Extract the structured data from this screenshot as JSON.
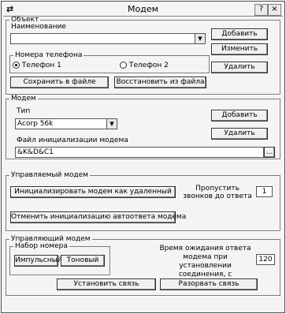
{
  "window": {
    "title": "Модем",
    "controls": {
      "help": "?",
      "close": "×"
    }
  },
  "object_group": {
    "legend": "Объект",
    "name_label": "Наименование",
    "name_value": "",
    "add_button": "Добавить",
    "edit_button": "Изменить",
    "delete_button": "Удалить",
    "phone_group": {
      "legend": "Номера телефона",
      "phone1": "Телефон 1",
      "phone2": "Телефон 2",
      "selected": "phone1"
    },
    "save_button": "Сохранить в файле",
    "restore_button": "Восстановить из файла"
  },
  "modem_group": {
    "legend": "Модем",
    "type_label": "Тип",
    "type_value": "Acorp 56k",
    "add_button": "Добавить",
    "delete_button": "Удалить",
    "init_file_label": "Файл инициализации модема",
    "init_file_value": "&K&D&C1",
    "browse_button": "..."
  },
  "managed_group": {
    "legend": "Управляемый модем",
    "init_remote_button": "Инициализировать модем как удаленный",
    "skip_rings_label": "Пропустить звонков до ответа",
    "skip_rings_value": "1",
    "cancel_autoanswer_button": "Отменить инициализацию автоответа модема"
  },
  "control_group": {
    "legend": "Управляющий модем",
    "dial_group": {
      "legend": "Набор номера",
      "pulse_button": "Импульсный",
      "tone_button": "Тоновый"
    },
    "timeout_label": "Время ожидания ответа модема при установлении соединения, с",
    "timeout_value": "120",
    "connect_button": "Установить связь",
    "disconnect_button": "Разорвать связь"
  }
}
